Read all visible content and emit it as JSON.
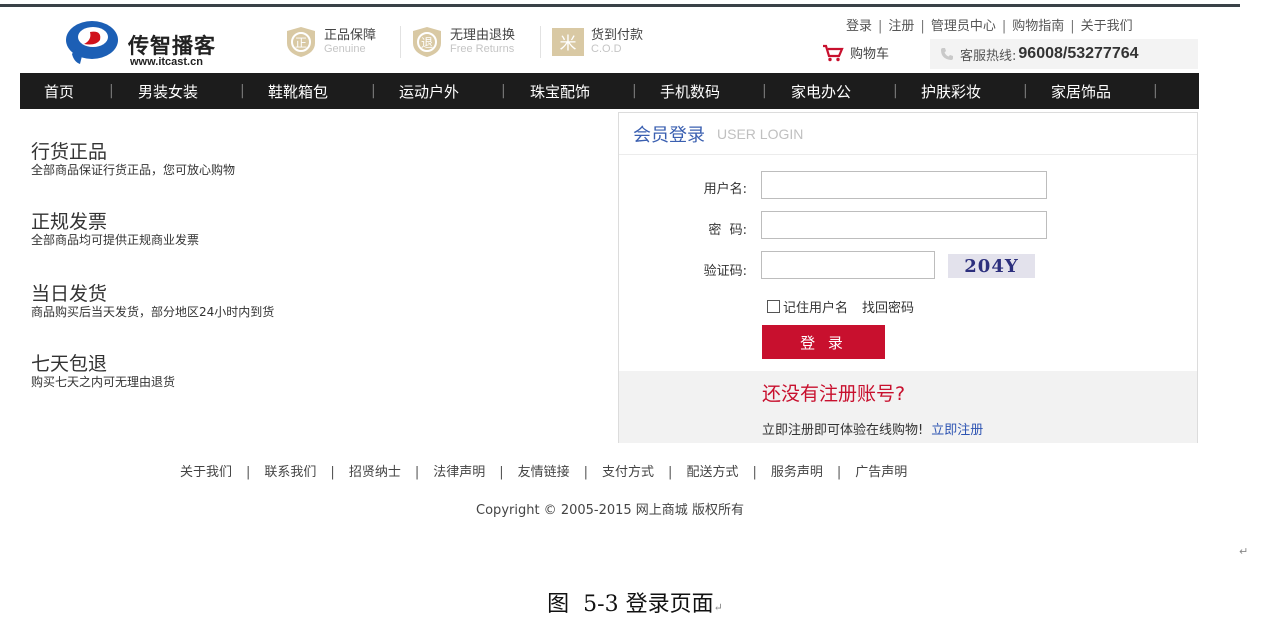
{
  "header": {
    "logo_title": "传智播客",
    "logo_url": "www.itcast.cn",
    "promos": [
      {
        "title": "正品保障",
        "sub": "Genuine",
        "icon": "正"
      },
      {
        "title": "无理由退换",
        "sub": "Free Returns",
        "icon": "退"
      },
      {
        "title": "货到付款",
        "sub": "C.O.D",
        "icon": "米"
      }
    ],
    "top_links": [
      "登录",
      "注册",
      "管理员中心",
      "购物指南",
      "关于我们"
    ],
    "cart_label": "购物车",
    "hotline_label": "客服热线:",
    "hotline_number": "96008/53277764"
  },
  "nav": {
    "items": [
      "首页",
      "男装女装",
      "鞋靴箱包",
      "运动户外",
      "珠宝配饰",
      "手机数码",
      "家电办公",
      "护肤彩妆",
      "家居饰品"
    ]
  },
  "features": [
    {
      "title": "行货正品",
      "desc": "全部商品保证行货正品，您可放心购物"
    },
    {
      "title": "正规发票",
      "desc": "全部商品均可提供正规商业发票"
    },
    {
      "title": "当日发货",
      "desc": "商品购买后当天发货，部分地区24小时内到货"
    },
    {
      "title": "七天包退",
      "desc": "购买七天之内可无理由退货"
    }
  ],
  "login": {
    "title": "会员登录",
    "subtitle": "USER LOGIN",
    "username_label": "用户名:",
    "password_label": "密  码:",
    "captcha_label": "验证码:",
    "username_value": "",
    "password_value": "",
    "captcha_value": "",
    "captcha_text": "204Y",
    "remember_label": "记住用户名",
    "find_password": "找回密码",
    "submit": "登 录",
    "register_title": "还没有注册账号?",
    "register_text": "立即注册即可体验在线购物!",
    "register_link": "立即注册"
  },
  "footer": {
    "links": [
      "关于我们",
      "联系我们",
      "招贤纳士",
      "法律声明",
      "友情链接",
      "支付方式",
      "配送方式",
      "服务声明",
      "广告声明"
    ],
    "copyright": "Copyright © 2005-2015 网上商城 版权所有"
  },
  "caption": "图  5-3 登录页面",
  "colors": {
    "accent_red": "#c8102e",
    "link_blue": "#2f55b3",
    "nav_bg": "#1c1c1c",
    "logo_blue": "#1c5fb5",
    "logo_red": "#d0121b"
  }
}
